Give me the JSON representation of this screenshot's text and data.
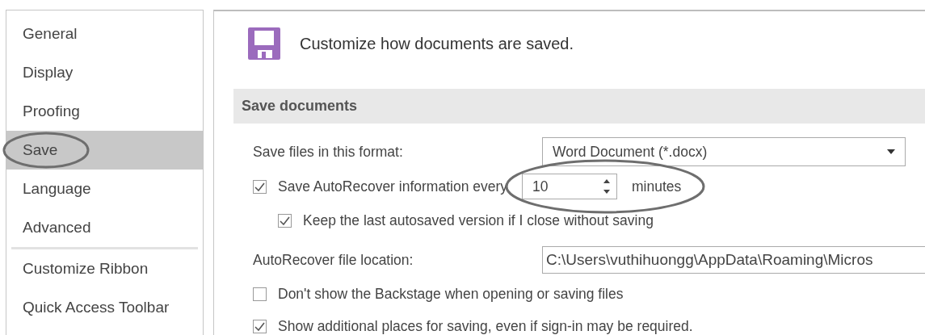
{
  "sidebar": {
    "groups": [
      [
        {
          "label": "General",
          "selected": false
        },
        {
          "label": "Display",
          "selected": false
        },
        {
          "label": "Proofing",
          "selected": false
        },
        {
          "label": "Save",
          "selected": true
        },
        {
          "label": "Language",
          "selected": false
        },
        {
          "label": "Advanced",
          "selected": false
        }
      ],
      [
        {
          "label": "Customize Ribbon",
          "selected": false
        },
        {
          "label": "Quick Access Toolbar",
          "selected": false
        }
      ]
    ]
  },
  "header": {
    "title": "Customize how documents are saved."
  },
  "section": {
    "title": "Save documents"
  },
  "rows": [
    {
      "kind": "select",
      "label": "Save files in this format:",
      "value": "Word Document (*.docx)"
    },
    {
      "kind": "spin",
      "checked": true,
      "label": "Save AutoRecover information every",
      "value": "10",
      "unit": "minutes",
      "children": [
        {
          "kind": "check",
          "checked": true,
          "label": "Keep the last autosaved version if I close without saving"
        }
      ]
    },
    {
      "kind": "path",
      "label": "AutoRecover file location:",
      "value": "C:\\Users\\vuthihuongg\\AppData\\Roaming\\Micros"
    },
    {
      "kind": "check",
      "checked": false,
      "label": "Don't show the Backstage when opening or saving files"
    },
    {
      "kind": "check",
      "checked": true,
      "label": "Show additional places for saving, even if sign-in may be required."
    }
  ]
}
